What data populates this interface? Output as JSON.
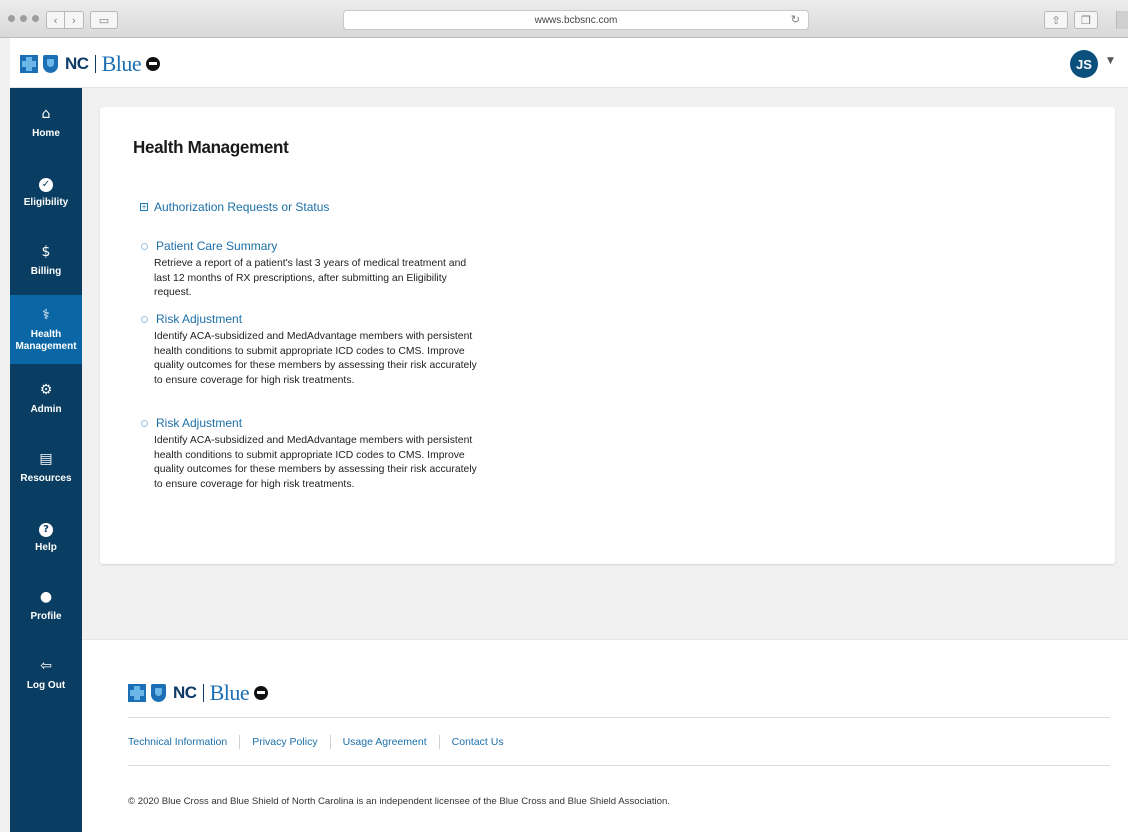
{
  "browser": {
    "url": "wwws.bcbsnc.com",
    "icons": {
      "back": "chevron-left-icon",
      "forward": "chevron-right-icon",
      "sidebar": "sidebar-icon",
      "reload": "reload-icon",
      "share": "share-icon",
      "tabs": "tabs-icon"
    }
  },
  "header": {
    "logo": {
      "nc": "NC",
      "blue": "Blue"
    },
    "user_initials": "JS",
    "avatar_color": "#0b4f7c"
  },
  "nav": {
    "bg_color": "#0a3d62",
    "active_color": "#0b66a6",
    "items": [
      {
        "label": "Home",
        "icon": "home-icon",
        "glyph": "⌂"
      },
      {
        "label": "Eligibility",
        "icon": "check-circle-icon",
        "glyph": "✓"
      },
      {
        "label": "Billing",
        "icon": "dollar-icon",
        "glyph": "$"
      },
      {
        "label": "Health Management",
        "icon": "caduceus-icon",
        "glyph": "⚕",
        "active": true
      },
      {
        "label": "Admin",
        "icon": "gear-icon",
        "glyph": "⚙"
      },
      {
        "label": "Resources",
        "icon": "document-icon",
        "glyph": "▤"
      },
      {
        "label": "Help",
        "icon": "question-icon",
        "glyph": "?"
      },
      {
        "label": "Profile",
        "icon": "person-icon",
        "glyph": "●"
      },
      {
        "label": "Log Out",
        "icon": "logout-icon",
        "glyph": "⇦"
      }
    ]
  },
  "main": {
    "title": "Health Management",
    "authorization": {
      "label": "Authorization Requests or Status",
      "expand_glyph": "+"
    },
    "sections": [
      {
        "label": "Patient Care Summary",
        "description": "Retrieve a report of a patient's last 3 years of medical treatment and last 12 months of RX prescriptions, after submitting an Eligibility request."
      },
      {
        "label": "Risk Adjustment",
        "description": "Identify ACA-subsidized and MedAdvantage members with persistent health conditions to submit appropriate ICD codes to CMS. Improve quality outcomes for these members by assessing their risk accurately to ensure coverage for high risk treatments."
      },
      {
        "label": "Risk Adjustment",
        "description": "Identify ACA-subsidized and MedAdvantage members with persistent health conditions to submit appropriate ICD codes to CMS. Improve quality outcomes for these members by assessing their risk accurately to ensure coverage for high risk treatments."
      }
    ],
    "link_color": "#1b6fa8"
  },
  "footer": {
    "links": [
      "Technical Information",
      "Privacy Policy",
      "Usage Agreement",
      "Contact Us"
    ],
    "copyright": "© 2020 Blue Cross and Blue Shield of North Carolina is an independent licensee of the Blue Cross and Blue Shield Association."
  }
}
